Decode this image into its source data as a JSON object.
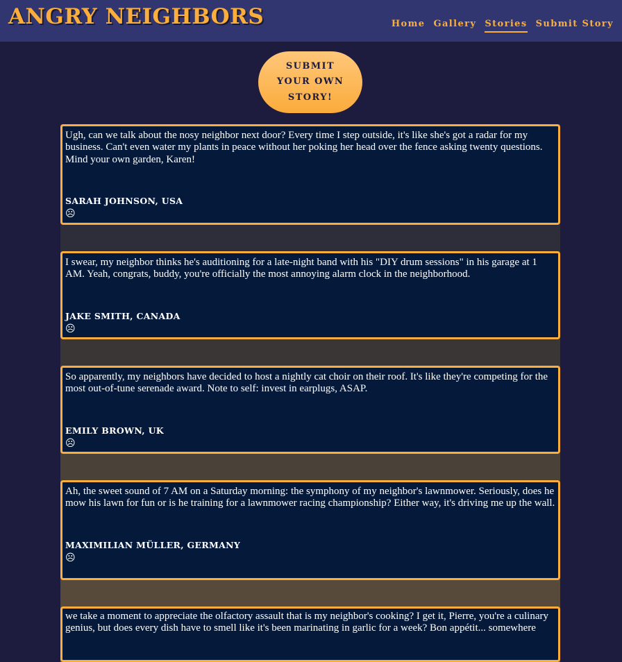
{
  "site": {
    "title": "ANGRY NEIGHBORS"
  },
  "nav": [
    {
      "label": "Home",
      "active": false
    },
    {
      "label": "Gallery",
      "active": false
    },
    {
      "label": "Stories",
      "active": true
    },
    {
      "label": "Submit Story",
      "active": false
    }
  ],
  "submit_button": {
    "label": "SUBMIT YOUR OWN STORY!"
  },
  "stories": [
    {
      "text": "Ugh, can we talk about the nosy neighbor next door? Every time I step outside, it's like she's got a radar for my business. Can't even water my plants in peace without her poking her head over the fence asking twenty questions. Mind your own garden, Karen!",
      "author": "SARAH JOHNSON, USA",
      "emoji": "☹",
      "band_color": "#2e2e3b"
    },
    {
      "text": "I swear, my neighbor thinks he's auditioning for a late-night band with his \"DIY drum sessions\" in his garage at 1 AM. Yeah, congrats, buddy, you're officially the most annoying alarm clock in the neighborhood.",
      "author": "JAKE SMITH, CANADA",
      "emoji": "☹",
      "band_color": "#3b3636"
    },
    {
      "text": "So apparently, my neighbors have decided to host a nightly cat choir on their roof. It's like they're competing for the most out-of-tune serenade award. Note to self: invest in earplugs, ASAP.",
      "author": "EMILY BROWN, UK",
      "emoji": "☹",
      "band_color": "#4a4238"
    },
    {
      "text": "Ah, the sweet sound of 7 AM on a Saturday morning: the symphony of my neighbor's lawnmower. Seriously, does he mow his lawn for fun or is he training for a lawnmower racing championship? Either way, it's driving me up the wall.",
      "author": "MAXIMILIAN MÜLLER, GERMANY",
      "emoji": "☹",
      "band_color": "#574a3a"
    },
    {
      "text": "we take a moment to appreciate the olfactory assault that is my neighbor's cooking? I get it, Pierre, you're a culinary genius, but does every dish have to smell like it's been marinating in garlic for a week? Bon appétit... somewhere",
      "author": "",
      "emoji": "",
      "band_color": "#5e4f3b"
    }
  ]
}
